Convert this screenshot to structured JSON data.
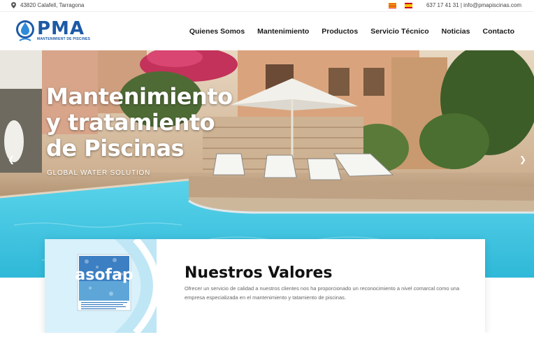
{
  "topbar": {
    "location": "43820 Calafell, Tarragona",
    "contact": "637 17 41 31 | info@pmapiscinas.com",
    "flags": [
      "cat-flag",
      "es-flag"
    ]
  },
  "header": {
    "logo_text": "PMA",
    "logo_subtitle": "MANTENIMIENT DE PISCINES",
    "nav": [
      "Quienes Somos",
      "Mantenimiento",
      "Productos",
      "Servicio Técnico",
      "Noticias",
      "Contacto"
    ]
  },
  "hero": {
    "title_line1": "Mantenimiento",
    "title_line2": "y tratamiento",
    "title_line3": "de Piscinas",
    "tagline": "GLOBAL WATER SOLUTION",
    "prev_icon": "chevron-left-icon",
    "next_icon": "chevron-right-icon"
  },
  "values": {
    "badge_text": "asofap",
    "heading": "Nuestros Valores",
    "body": "Ofrecer un servicio de calidad a nuestros clientes nos ha proporcionado un reconocimiento a nivel comarcal como una empresa especializada en el mantenimiento y tatamiento de piscinas."
  },
  "colors": {
    "brand": "#1c5aa6",
    "pool": "#3fc6e0",
    "accent_light": "#d9f1fa"
  }
}
